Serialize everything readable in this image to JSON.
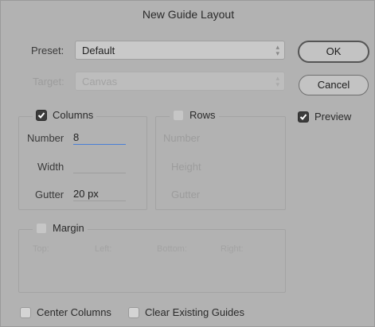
{
  "dialog": {
    "title": "New Guide Layout",
    "preset": {
      "label": "Preset:",
      "value": "Default"
    },
    "target": {
      "label": "Target:",
      "value": "Canvas"
    },
    "ok_label": "OK",
    "cancel_label": "Cancel",
    "preview": {
      "label": "Preview",
      "checked": true
    },
    "columns": {
      "label": "Columns",
      "checked": true,
      "number_label": "Number",
      "number_value": "8",
      "width_label": "Width",
      "width_value": "",
      "gutter_label": "Gutter",
      "gutter_value": "20 px"
    },
    "rows": {
      "label": "Rows",
      "checked": false,
      "number_label": "Number",
      "height_label": "Height",
      "gutter_label": "Gutter"
    },
    "margin": {
      "label": "Margin",
      "checked": false,
      "top_label": "Top:",
      "left_label": "Left:",
      "bottom_label": "Bottom:",
      "right_label": "Right:"
    },
    "center_columns": {
      "label": "Center Columns",
      "checked": false
    },
    "clear_guides": {
      "label": "Clear Existing Guides",
      "checked": false
    }
  }
}
